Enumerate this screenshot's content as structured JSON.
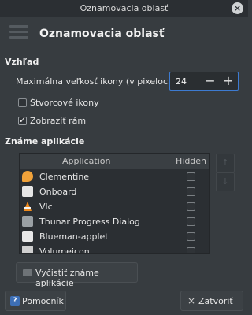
{
  "window": {
    "title": "Oznamovacia oblasť"
  },
  "header": {
    "title": "Oznamovacia oblasť"
  },
  "appearance": {
    "section_label": "Vzhľad",
    "max_icon_size_label": "Maximálna veľkosť ikony (v pixeloch):",
    "max_icon_size_value": "24",
    "square_icons_label": "Štvorcové ikony",
    "square_icons_checked": false,
    "show_frame_label": "Zobraziť rám",
    "show_frame_checked": true
  },
  "known_apps": {
    "section_label": "Známe aplikácie",
    "columns": {
      "application": "Application",
      "hidden": "Hidden"
    },
    "rows": [
      {
        "name": "Clementine",
        "icon": "clementine-icon",
        "color": "#f0a23a",
        "hidden": false
      },
      {
        "name": "Onboard",
        "icon": "onboard-icon",
        "color": "#e6e6e6",
        "hidden": false
      },
      {
        "name": "Vlc",
        "icon": "vlc-icon",
        "color": "#f08a1c",
        "hidden": false
      },
      {
        "name": "Thunar Progress Dialog",
        "icon": "thunar-icon",
        "color": "#9aa0a4",
        "hidden": false
      },
      {
        "name": "Blueman-applet",
        "icon": "blueman-icon",
        "color": "#e8e8e8",
        "hidden": false
      },
      {
        "name": "Volumeicon",
        "icon": "volumeicon-icon",
        "color": "#cfcfcf",
        "hidden": false
      }
    ],
    "clear_button_label": "Vyčistiť známe aplikácie"
  },
  "footer": {
    "help_label": "Pomocník",
    "close_label": "Zatvoriť"
  },
  "colors": {
    "accent": "#3d7bd1",
    "background": "#373c40"
  }
}
